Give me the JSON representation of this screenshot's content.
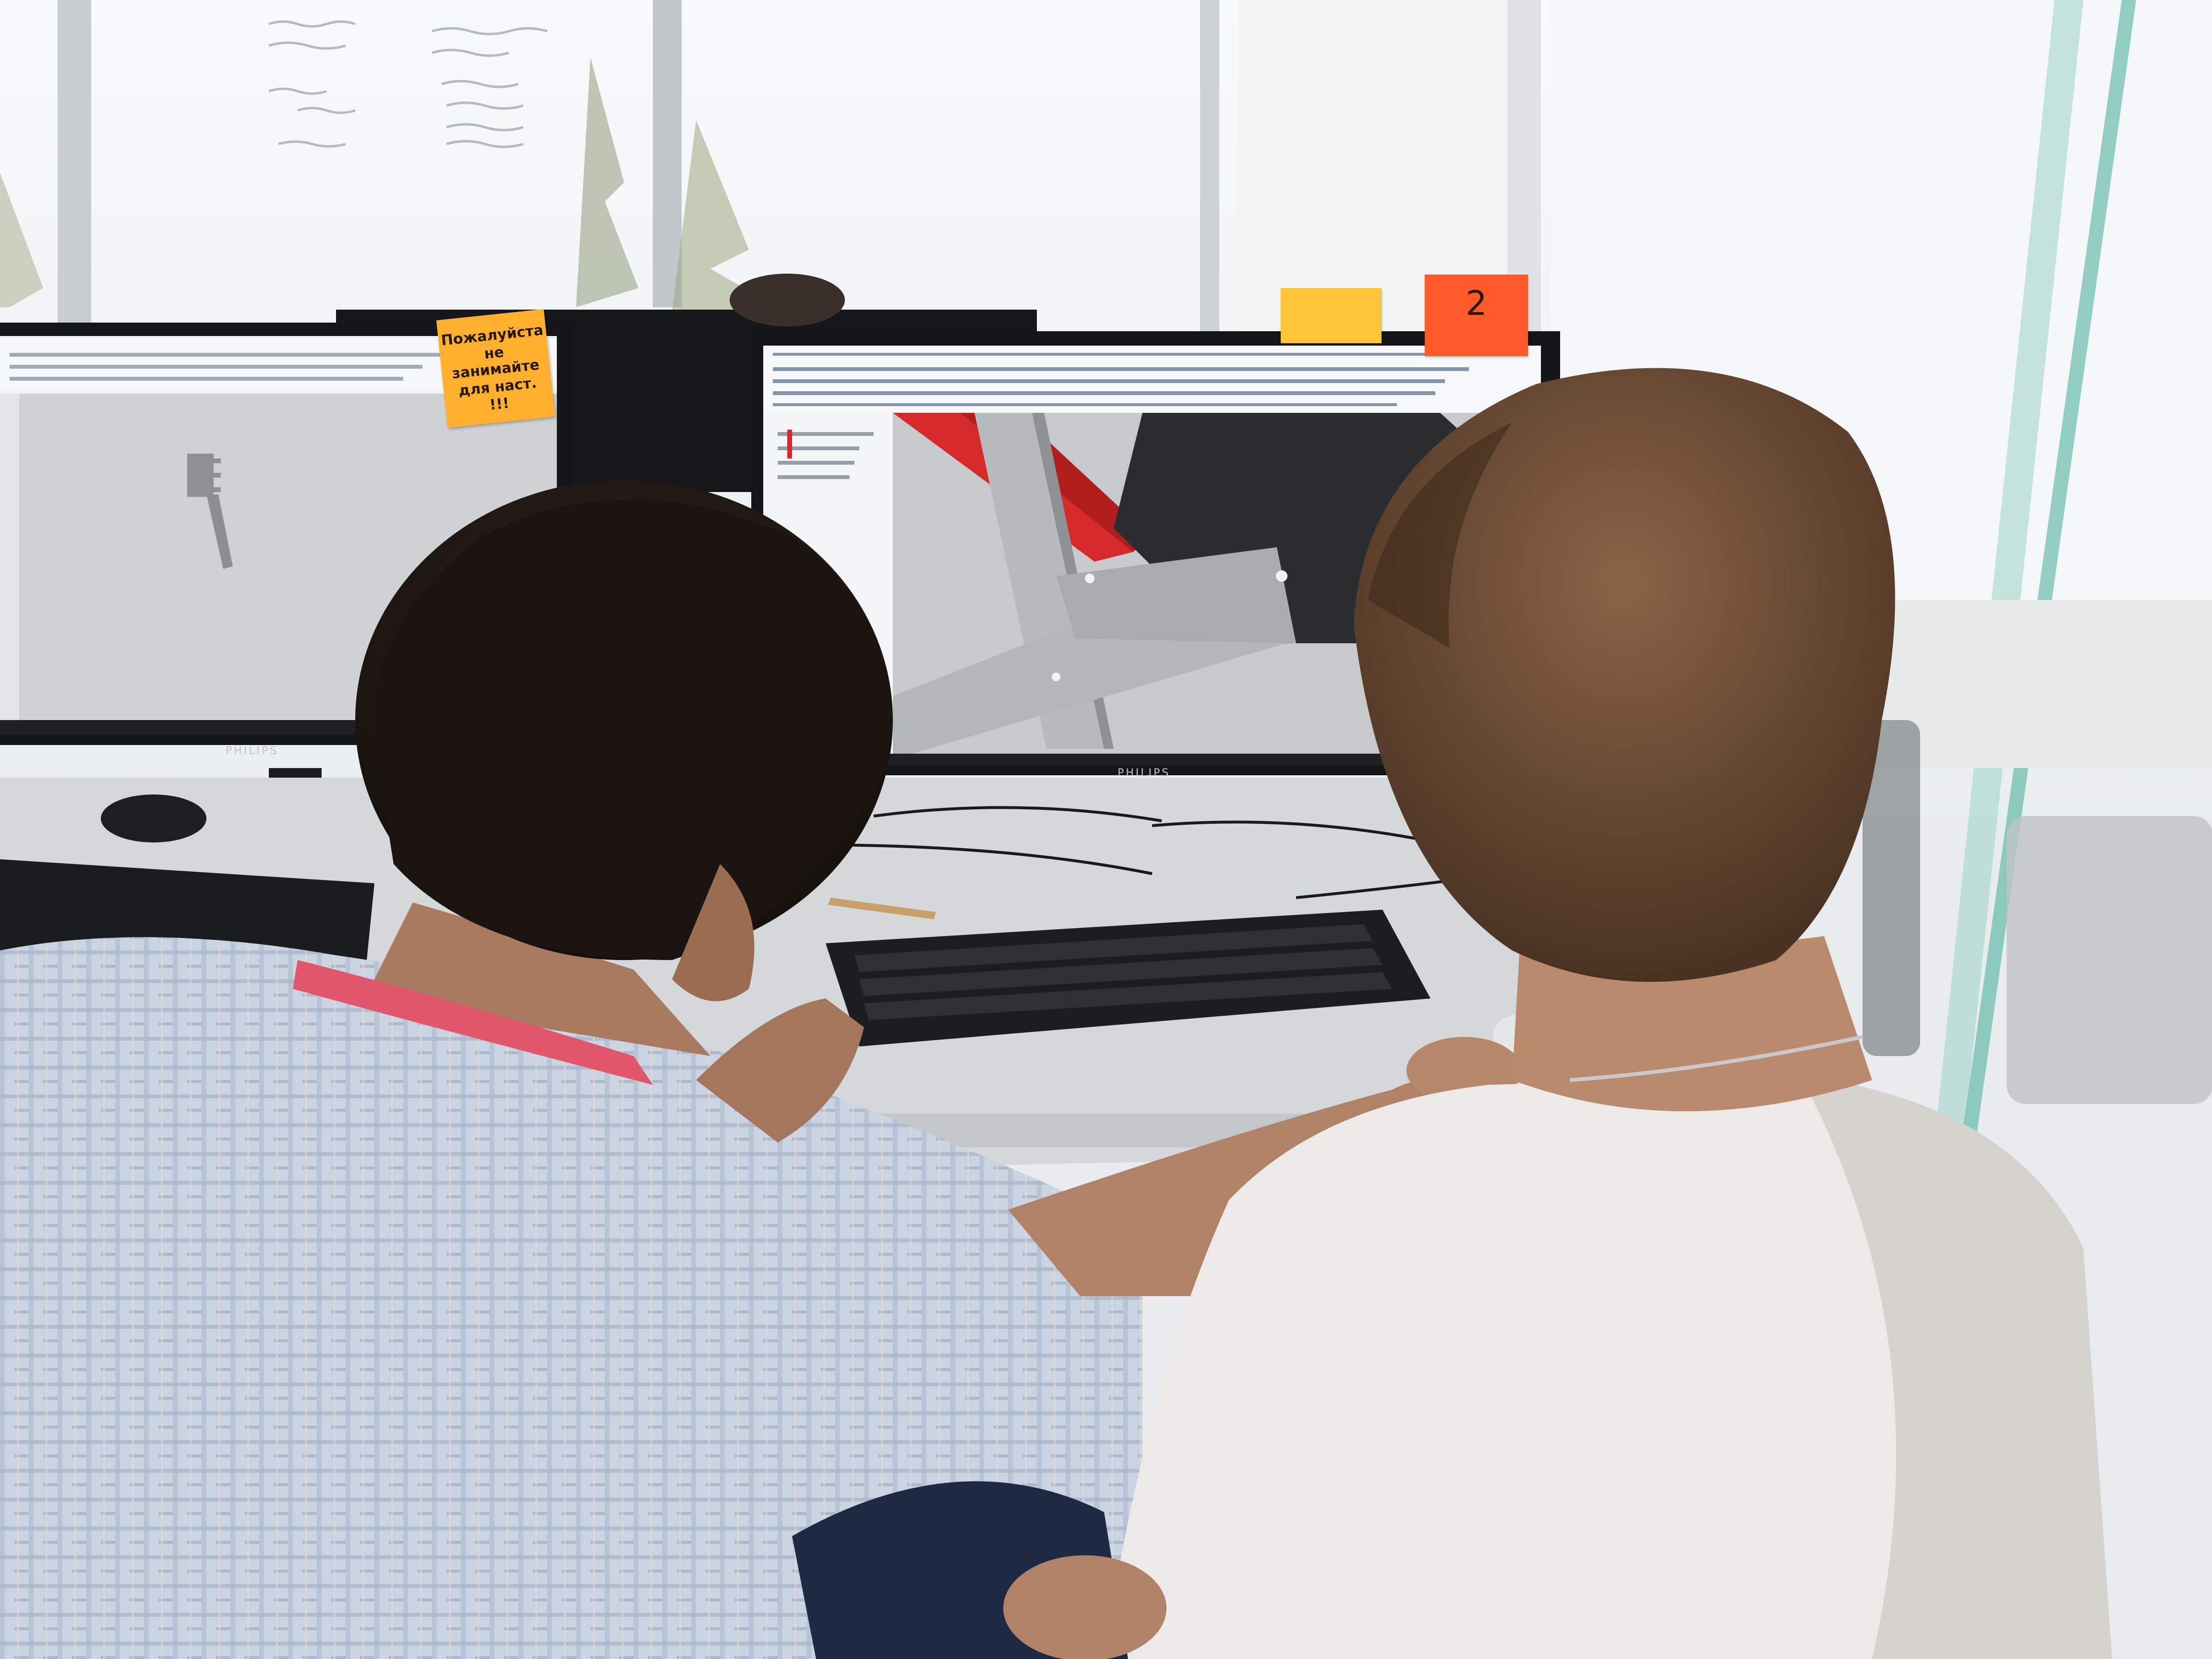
{
  "photo": {
    "description_free": true,
    "monitor_brand": "PHILIPS",
    "sticky_note_left": [
      "Пожалуйста",
      "не занимайте",
      "для наст.",
      "!!!"
    ],
    "sticky_note_number": "2",
    "colors": {
      "sky": "#f4f7f8",
      "cad_background": "#c9cbcc",
      "cad_panel": "#f2f3f4",
      "beam_grey": "#b8bbbd",
      "beam_red": "#d42a2a",
      "hair_dark": "#241a14",
      "hair_brown": "#6a4a32",
      "shirt_checked": "#b9c6d8",
      "tshirt_white": "#ece9e6",
      "lanyard": "#e0566a",
      "desk": "#d9dcdd",
      "keyboard": "#1c1d1f",
      "sticky_orange": "#ffb02e",
      "sticky_red": "#ff5a2c"
    }
  }
}
